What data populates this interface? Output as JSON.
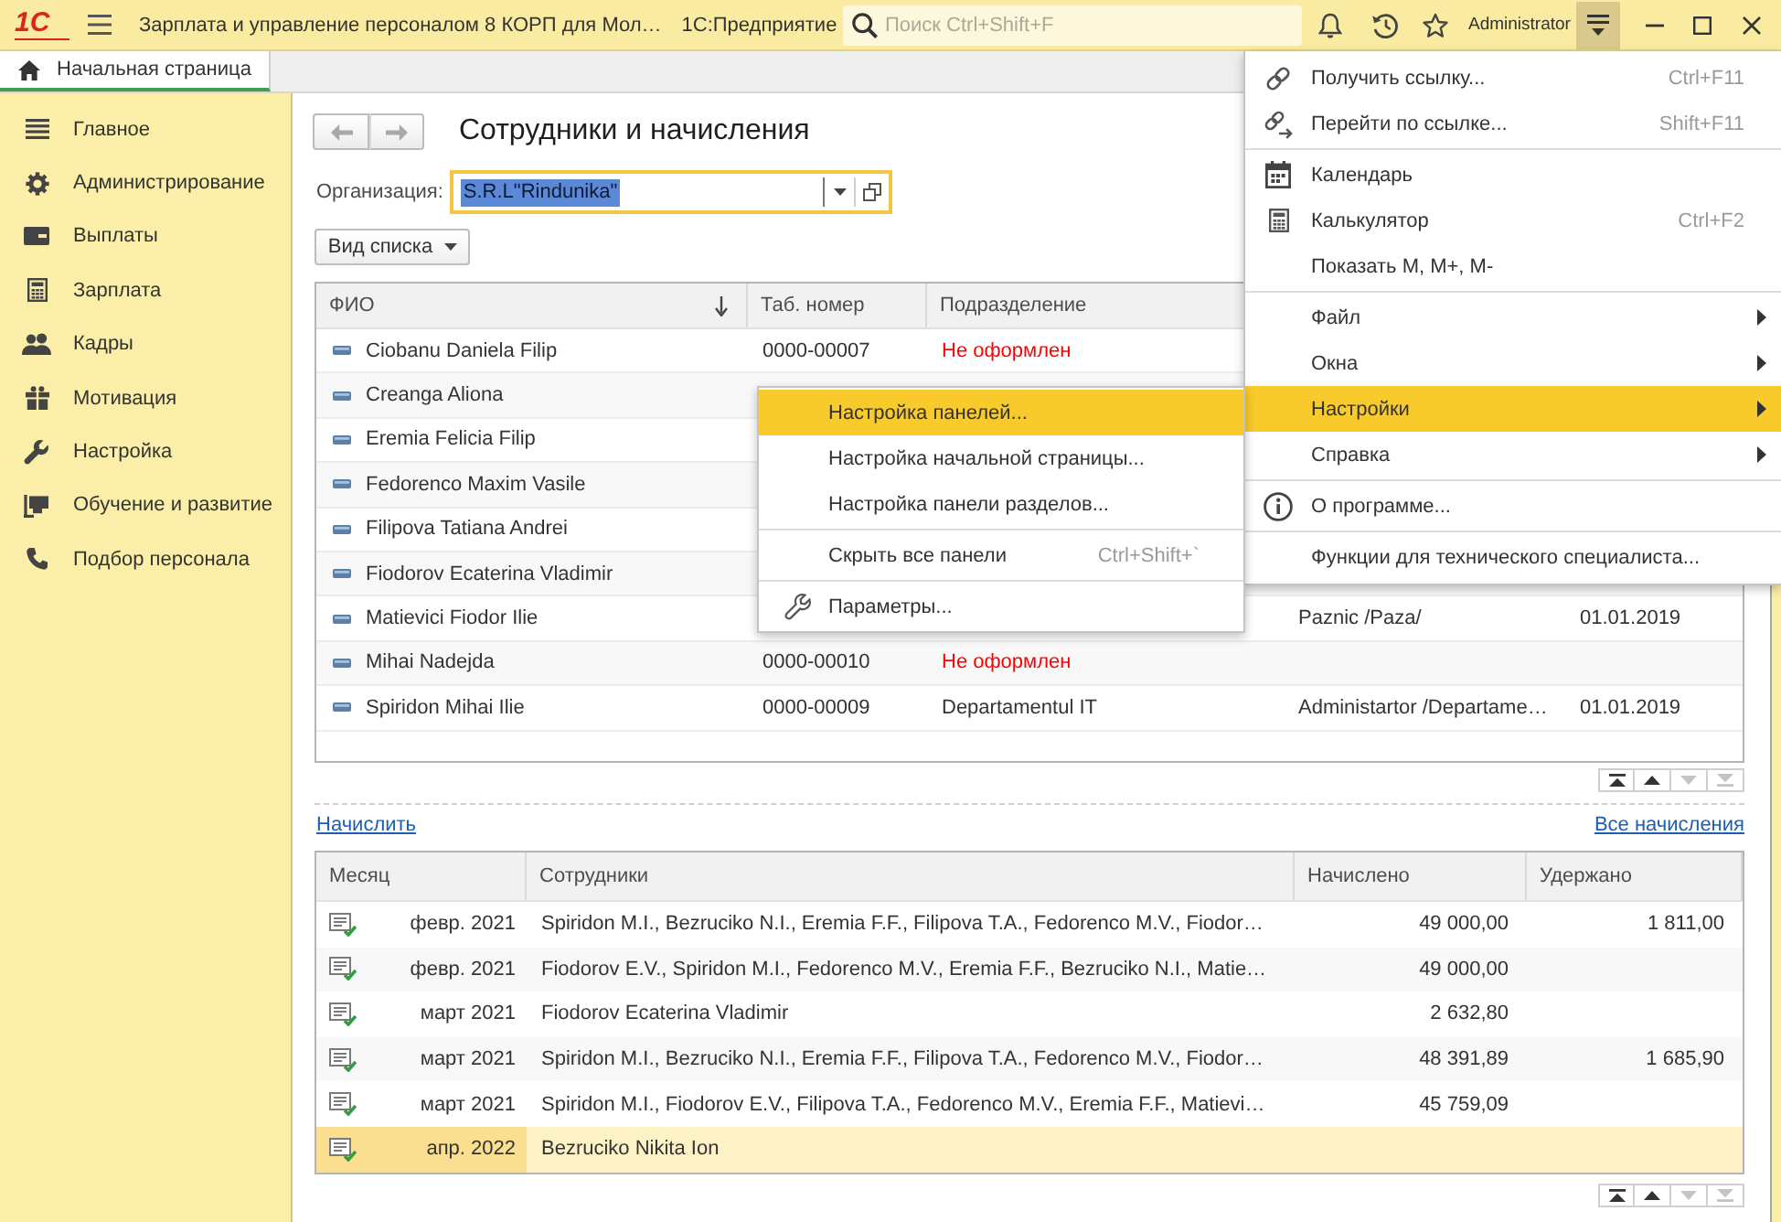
{
  "top_bar": {
    "logo": "1С",
    "title": "Зарплата и управление персоналом 8 КОРП для Мол…",
    "platform": "1С:Предприятие",
    "search": {
      "placeholder": "Поиск Ctrl+Shift+F"
    },
    "user": "Administrator",
    "main_menu_open": true
  },
  "tabs": [
    {
      "label": "Начальная страница",
      "selected": true
    }
  ],
  "sections": [
    {
      "label": "Главное"
    },
    {
      "label": "Администрирование"
    },
    {
      "label": "Выплаты"
    },
    {
      "label": "Зарплата"
    },
    {
      "label": "Кадры"
    },
    {
      "label": "Мотивация"
    },
    {
      "label": "Настройка"
    },
    {
      "label": "Обучение и развитие"
    },
    {
      "label": "Подбор персонала"
    }
  ],
  "form": {
    "title": "Сотрудники и начисления",
    "back": {
      "disabled": true
    },
    "forward": {
      "disabled": true
    },
    "organization": {
      "label": "Организация:",
      "value": "S.R.L\"Rindunika\"",
      "focused": true,
      "value_selected": true
    },
    "list_view_button": "Вид списка",
    "employees": {
      "columns": [
        {
          "label": "ФИО",
          "sorted": true
        },
        {
          "label": "Таб. номер",
          "sorted": false
        },
        {
          "label": "Подразделение",
          "sorted": false
        }
      ],
      "rows": [
        {
          "name": "Ciobanu Daniela Filip",
          "tab_number": "0000-00007",
          "department": "Не оформлен",
          "department_alert": true
        },
        {
          "name": "Creanga Aliona"
        },
        {
          "name": "Eremia Felicia Filip"
        },
        {
          "name": "Fedorenco Maxim Vasile"
        },
        {
          "name": "Filipova Tatiana Andrei"
        },
        {
          "name": "Fiodorov Ecaterina Vladimir"
        },
        {
          "name": "Matievici Fiodor Ilie",
          "column_4": "Paznic /Paza/",
          "column_5": "01.01.2019"
        },
        {
          "name": "Mihai Nadejda",
          "tab_number": "0000-00010",
          "department": "Не оформлен",
          "department_alert": true
        },
        {
          "name": "Spiridon Mihai Ilie",
          "tab_number": "0000-00009",
          "department": "Departamentul IT",
          "department_alert": false,
          "column_4": "Administartor /Departame…",
          "column_5": "01.01.2019"
        }
      ],
      "pager": [
        {
          "disabled": false
        },
        {
          "disabled": false
        },
        {
          "disabled": true
        },
        {
          "disabled": true
        }
      ]
    },
    "links": [
      {
        "label": "Начислить"
      },
      {
        "label": "Все начисления"
      }
    ],
    "accruals": {
      "columns": [
        {
          "label": "Месяц"
        },
        {
          "label": "Сотрудники"
        },
        {
          "label": "Начислено"
        },
        {
          "label": "Удержано"
        }
      ],
      "rows": [
        {
          "month": "февр. 2021",
          "employees": "Spiridon M.I., Bezruciko N.I., Eremia F.F., Filipova T.A., Fedorenco M.V., Fiodor…",
          "accrued": "49 000,00",
          "withheld": "1 811,00",
          "selected": false
        },
        {
          "month": "февр. 2021",
          "employees": "Fiodorov E.V., Spiridon M.I., Fedorenco M.V., Eremia F.F., Bezruciko N.I., Matie…",
          "accrued": "49 000,00",
          "selected": false
        },
        {
          "month": "март 2021",
          "employees": "Fiodorov Ecaterina Vladimir",
          "accrued": "2 632,80",
          "selected": false
        },
        {
          "month": "март 2021",
          "employees": "Spiridon M.I., Bezruciko N.I., Eremia F.F., Filipova T.A., Fedorenco M.V., Fiodor…",
          "accrued": "48 391,89",
          "withheld": "1 685,90",
          "selected": false
        },
        {
          "month": "март 2021",
          "employees": "Spiridon M.I., Fiodorov E.V., Filipova T.A., Fedorenco M.V., Eremia F.F., Matievi…",
          "accrued": "45 759,09",
          "selected": false
        },
        {
          "month": "апр. 2022",
          "employees": "Bezruciko Nikita Ion",
          "selected": true
        }
      ],
      "pager": [
        {
          "disabled": false
        },
        {
          "disabled": false
        },
        {
          "disabled": true
        },
        {
          "disabled": true
        }
      ]
    }
  },
  "main_menu": {
    "groups": [
      [
        {
          "kind": "link",
          "label": "Получить ссылку...",
          "shortcut": "Ctrl+F11",
          "submenu": false,
          "selected": false
        },
        {
          "kind": "goto",
          "label": "Перейти по ссылке...",
          "shortcut": "Shift+F11",
          "submenu": false,
          "selected": false
        }
      ],
      [
        {
          "kind": "calendar",
          "label": "Календарь",
          "submenu": false,
          "selected": false
        },
        {
          "kind": "calculator",
          "label": "Калькулятор",
          "shortcut": "Ctrl+F2",
          "submenu": false,
          "selected": false
        },
        {
          "kind": "plain",
          "label": "Показать M, M+, M-",
          "submenu": false,
          "selected": false
        }
      ],
      [
        {
          "kind": "plain",
          "label": "Файл",
          "submenu": true,
          "selected": false
        },
        {
          "kind": "plain",
          "label": "Окна",
          "submenu": true,
          "selected": false
        },
        {
          "kind": "plain",
          "label": "Настройки",
          "submenu": true,
          "selected": true
        },
        {
          "kind": "plain",
          "label": "Справка",
          "submenu": true,
          "selected": false
        }
      ],
      [
        {
          "kind": "info",
          "label": "О программе...",
          "submenu": false,
          "selected": false
        }
      ],
      [
        {
          "kind": "plain",
          "label": "Функции для технического специалиста...",
          "submenu": false,
          "selected": false
        }
      ]
    ]
  },
  "submenu": {
    "groups": [
      [
        {
          "kind": "plain",
          "label": "Настройка панелей...",
          "submenu": false,
          "selected": true
        },
        {
          "kind": "plain",
          "label": "Настройка начальной страницы...",
          "submenu": false,
          "selected": false
        },
        {
          "kind": "plain",
          "label": "Настройка панели разделов...",
          "submenu": false,
          "selected": false
        }
      ],
      [
        {
          "kind": "plain",
          "label": "Скрыть все панели",
          "shortcut": "Ctrl+Shift+`",
          "submenu": false,
          "selected": false
        }
      ],
      [
        {
          "kind": "wrench",
          "label": "Параметры...",
          "submenu": false,
          "selected": false
        }
      ]
    ]
  }
}
